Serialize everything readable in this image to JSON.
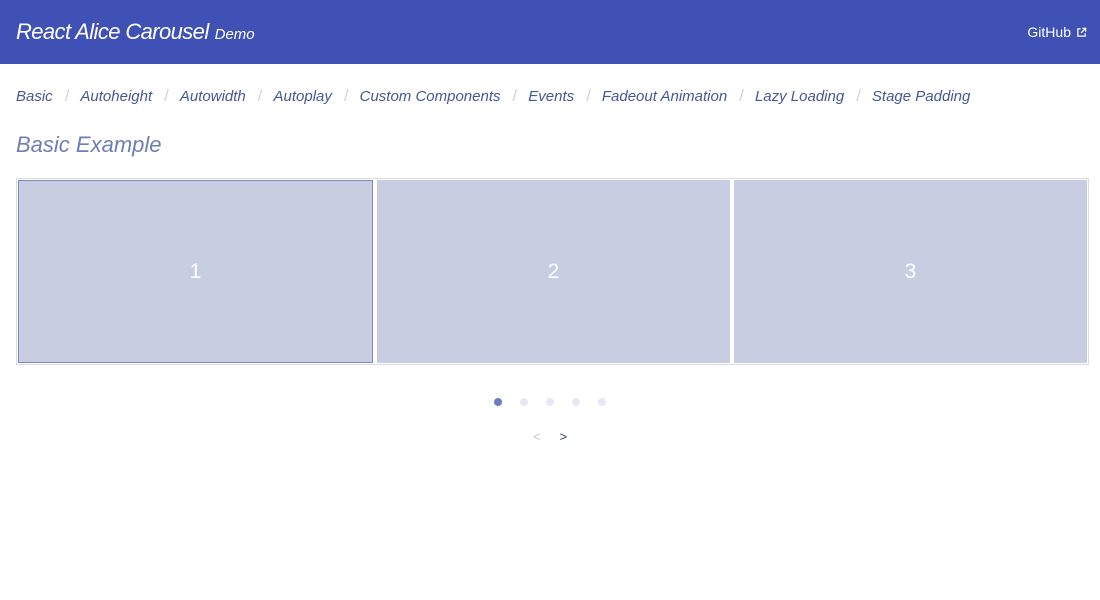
{
  "header": {
    "title": "React Alice Carousel",
    "subtitle": "Demo",
    "github_label": "GitHub"
  },
  "nav": {
    "items": [
      "Basic",
      "Autoheight",
      "Autowidth",
      "Autoplay",
      "Custom Components",
      "Events",
      "Fadeout Animation",
      "Lazy Loading",
      "Stage Padding"
    ],
    "separator": "/"
  },
  "main": {
    "section_title": "Basic Example"
  },
  "carousel": {
    "slides": [
      "1",
      "2",
      "3"
    ],
    "active_slide_index": 0,
    "dot_count": 5,
    "active_dot_index": 0,
    "prev_label": "<",
    "next_label": ">"
  },
  "colors": {
    "header_bg": "#3f51b5",
    "slide_bg": "#c9cde1",
    "link_text": "#465798",
    "dot_active": "#6f7bbf",
    "dot_inactive": "#e5e7f4"
  },
  "icons": {
    "github_link": "external-link-icon"
  }
}
